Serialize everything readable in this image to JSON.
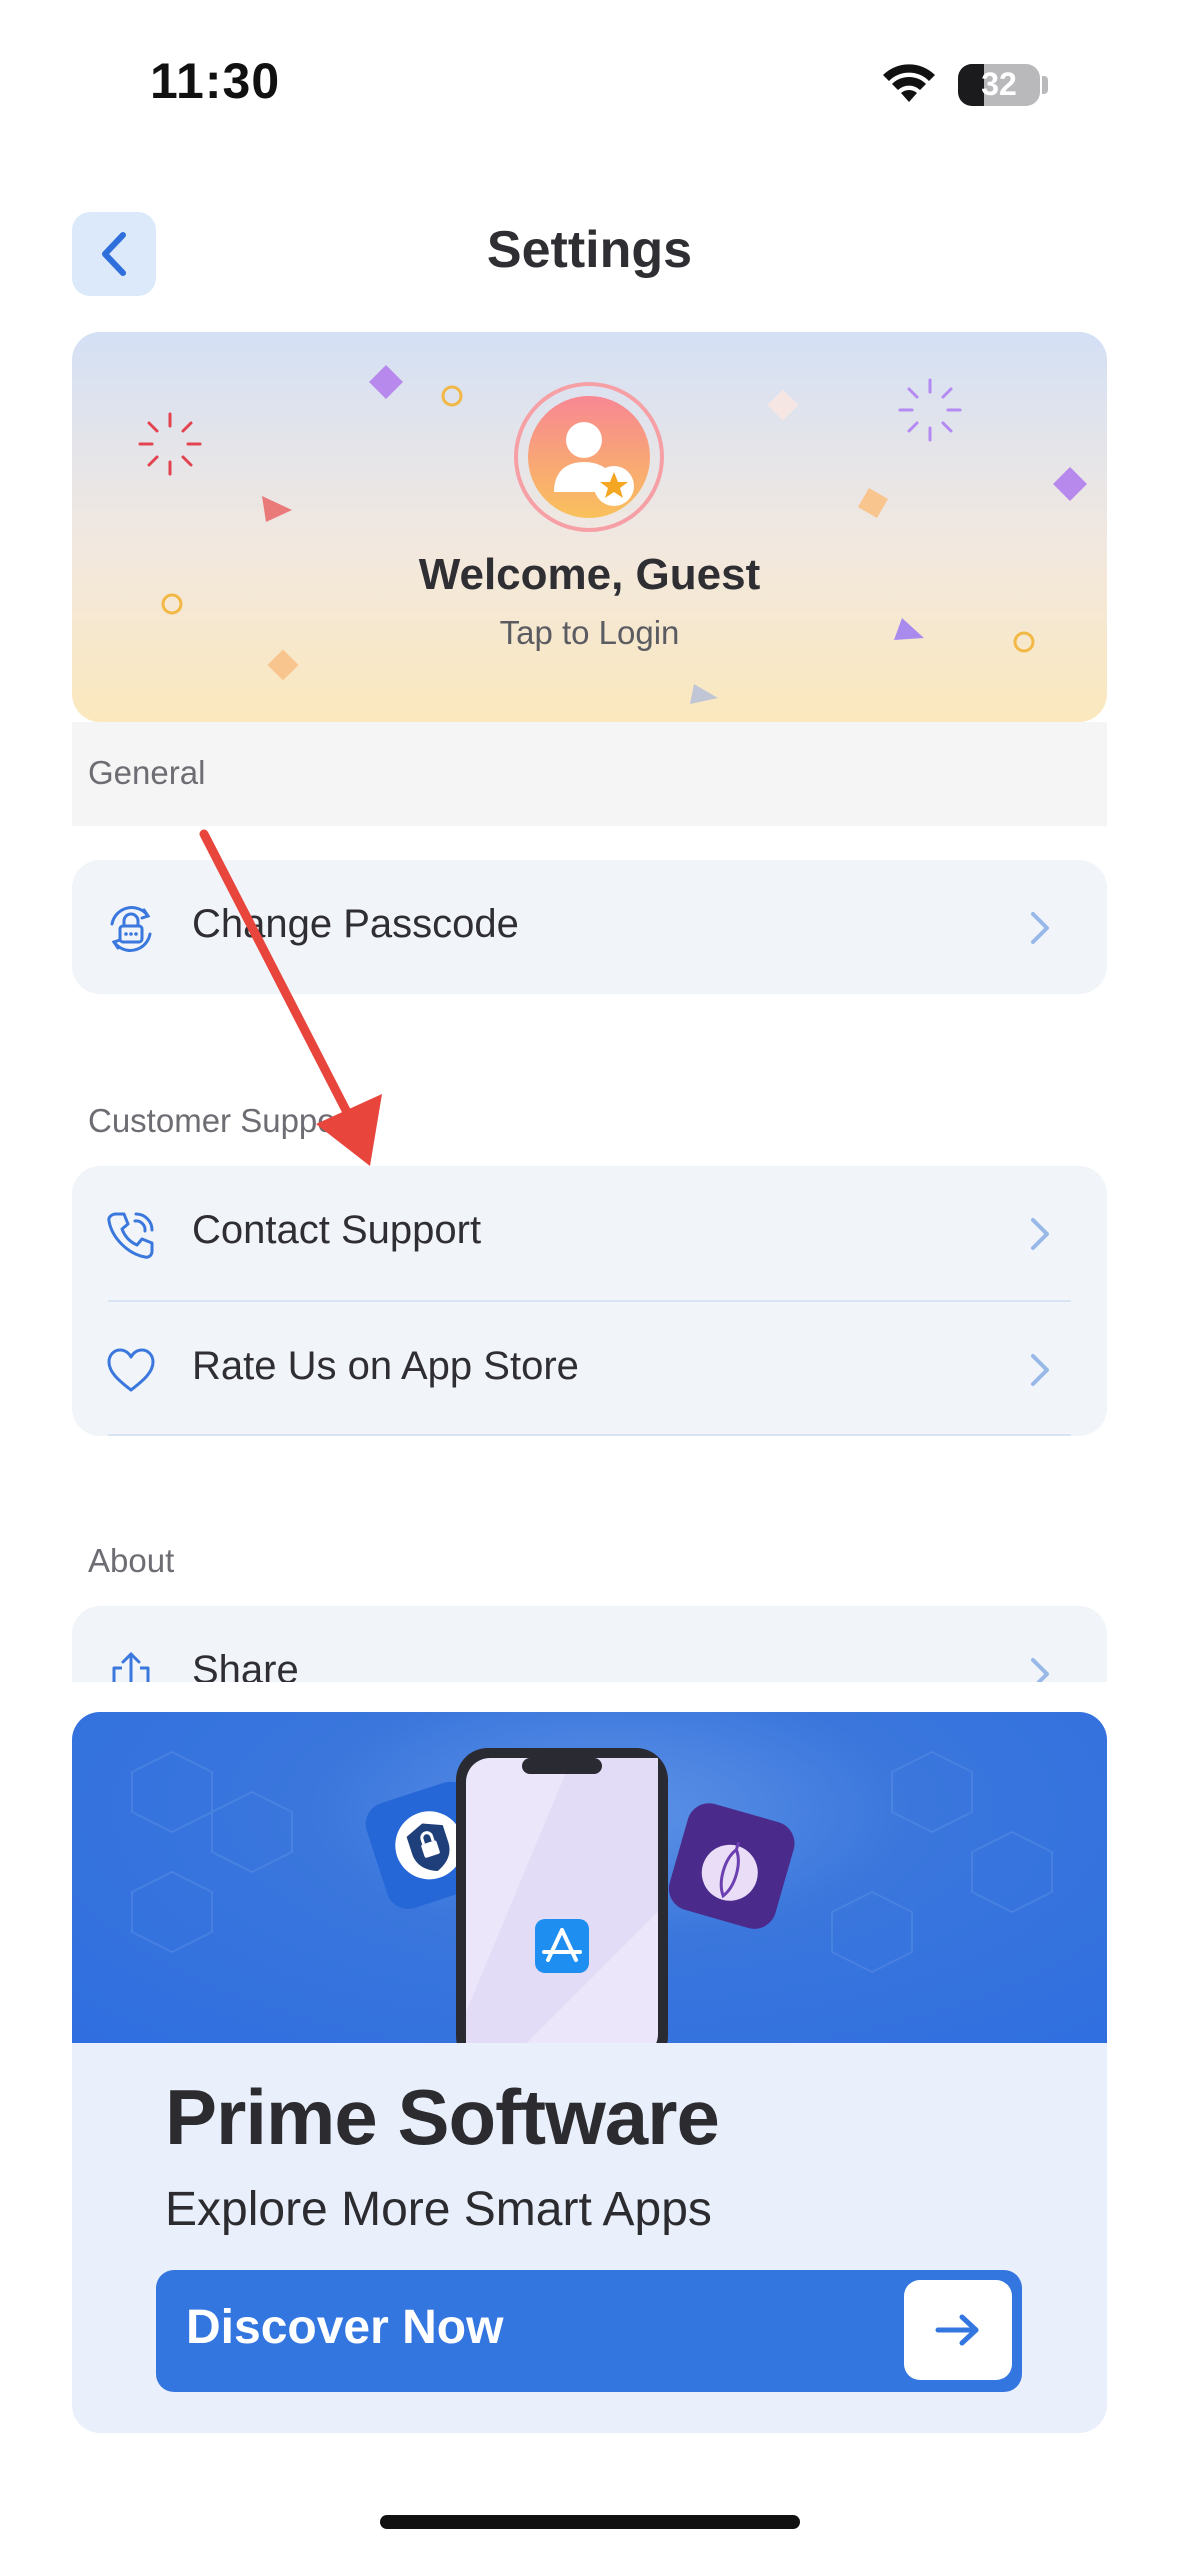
{
  "status_bar": {
    "time": "11:30",
    "battery": "32",
    "battery_level": 0.32
  },
  "header": {
    "title": "Settings",
    "back_icon": "chevron-left-icon"
  },
  "welcome": {
    "name": "Welcome, Guest",
    "subtitle": "Tap to Login"
  },
  "sections": {
    "general": {
      "label": "General",
      "items": [
        {
          "label": "Change Passcode",
          "icon": "lock-icon"
        }
      ]
    },
    "support": {
      "label": "Customer Support",
      "items": [
        {
          "label": "Contact Support",
          "icon": "phone-icon"
        },
        {
          "label": "Rate Us on App Store",
          "icon": "heart-icon"
        }
      ]
    },
    "about": {
      "label": "About",
      "items": [
        {
          "label": "Share",
          "icon": "share-icon"
        }
      ]
    }
  },
  "promo": {
    "title": "Prime Software",
    "subtitle": "Explore More Smart Apps",
    "button_label": "Discover Now"
  },
  "colors": {
    "accent": "#3476e0",
    "annotation": "#e8453c"
  }
}
